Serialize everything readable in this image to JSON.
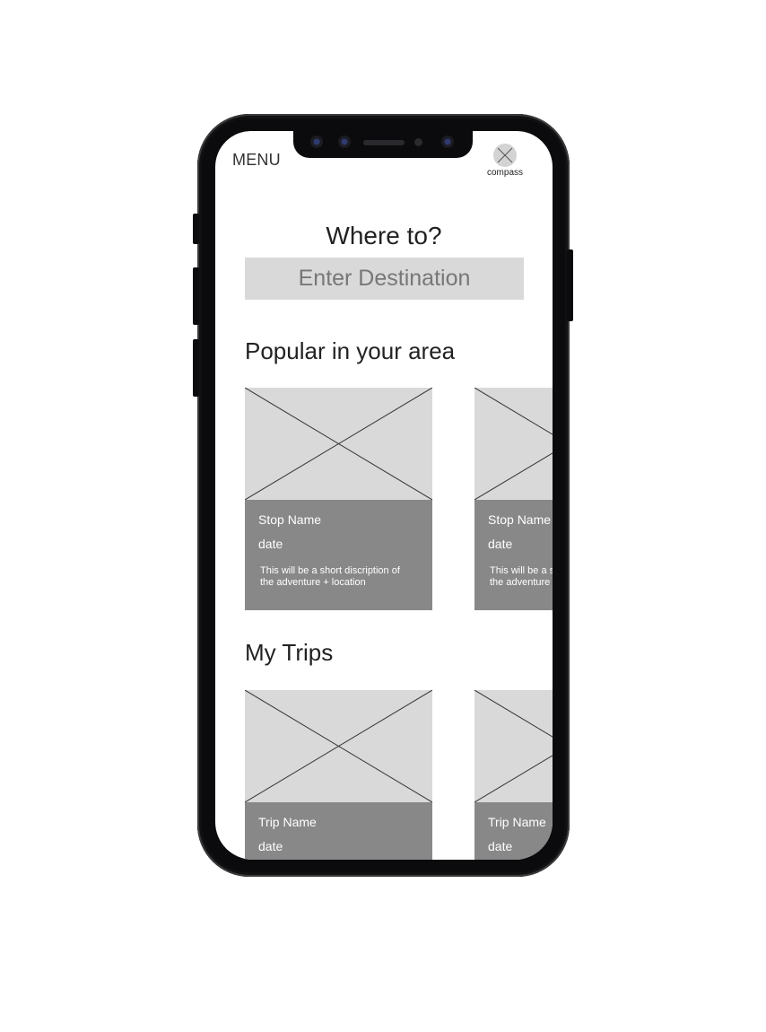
{
  "header": {
    "menu_label": "MENU",
    "compass_label": "compass"
  },
  "search": {
    "title": "Where to?",
    "placeholder": "Enter Destination"
  },
  "popular": {
    "heading": "Popular in your area",
    "cards": [
      {
        "name": "Stop Name",
        "date": "date",
        "description": "This will be a short discription of the adventure + location"
      },
      {
        "name": "Stop Name",
        "date": "date",
        "description": "This will be a short discription of the adventure + location"
      }
    ]
  },
  "trips": {
    "heading": "My Trips",
    "cards": [
      {
        "name": "Trip Name",
        "date": "date"
      },
      {
        "name": "Trip Name",
        "date": "date"
      }
    ]
  },
  "colors": {
    "placeholder_bg": "#d9d9d9",
    "card_info_bg": "#888888",
    "phone_frame": "#0b0b0d"
  }
}
